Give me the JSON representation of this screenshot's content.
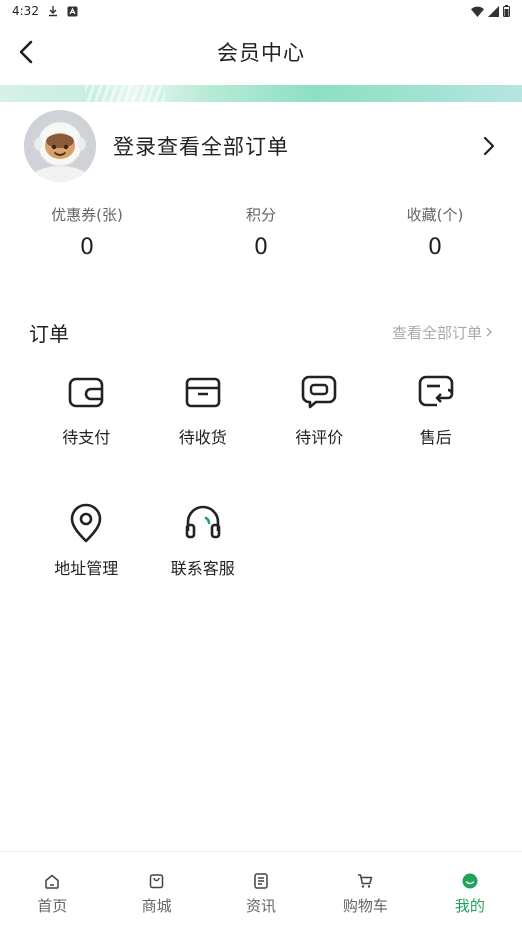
{
  "status_bar": {
    "time": "4:32"
  },
  "nav": {
    "title": "会员中心"
  },
  "profile": {
    "login_text": "登录查看全部订单"
  },
  "stats": [
    {
      "label": "优惠券(张)",
      "value": "0"
    },
    {
      "label": "积分",
      "value": "0"
    },
    {
      "label": "收藏(个)",
      "value": "0"
    }
  ],
  "orders": {
    "title": "订单",
    "view_all": "查看全部订单",
    "items": [
      {
        "label": "待支付",
        "icon": "wallet-icon"
      },
      {
        "label": "待收货",
        "icon": "box-icon"
      },
      {
        "label": "待评价",
        "icon": "comment-icon"
      },
      {
        "label": "售后",
        "icon": "return-icon"
      }
    ]
  },
  "services": {
    "items": [
      {
        "label": "地址管理",
        "icon": "location-pin-icon"
      },
      {
        "label": "联系客服",
        "icon": "headset-icon"
      }
    ]
  },
  "tabs": [
    {
      "label": "首页",
      "icon": "home-icon"
    },
    {
      "label": "商城",
      "icon": "shopping-bag-icon"
    },
    {
      "label": "资讯",
      "icon": "document-icon"
    },
    {
      "label": "购物车",
      "icon": "cart-icon"
    },
    {
      "label": "我的",
      "icon": "profile-icon",
      "active": true
    }
  ],
  "colors": {
    "accent": "#22a35a",
    "muted_text": "#aaaaaa"
  }
}
